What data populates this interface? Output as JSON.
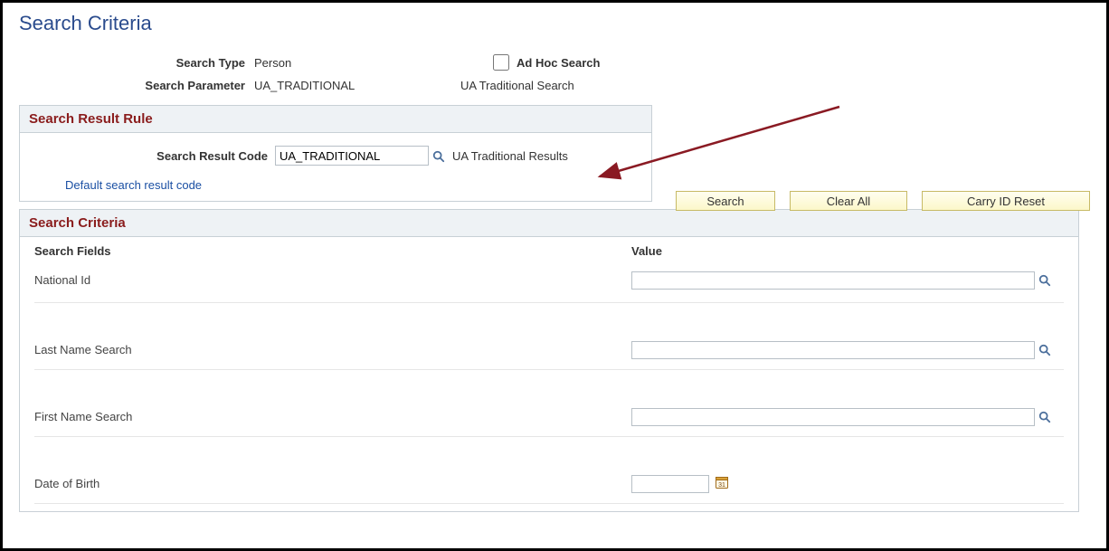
{
  "page": {
    "title": "Search Criteria"
  },
  "header": {
    "search_type_label": "Search Type",
    "search_type_value": "Person",
    "ad_hoc_label": "Ad Hoc Search",
    "search_param_label": "Search Parameter",
    "search_param_value": "UA_TRADITIONAL",
    "search_param_desc": "UA Traditional Search"
  },
  "result_rule": {
    "section_title": "Search Result Rule",
    "code_label": "Search Result Code",
    "code_value": "UA_TRADITIONAL",
    "code_desc": "UA Traditional Results",
    "default_link": "Default search result code"
  },
  "buttons": {
    "search": "Search",
    "clear_all": "Clear All",
    "carry_id_reset": "Carry ID Reset"
  },
  "criteria": {
    "section_title": "Search Criteria",
    "fields_header": "Search Fields",
    "value_header": "Value",
    "fields": [
      {
        "label": "National Id",
        "type": "lookup",
        "value": ""
      },
      {
        "label": "Last Name Search",
        "type": "lookup",
        "value": ""
      },
      {
        "label": "First Name Search",
        "type": "lookup",
        "value": ""
      },
      {
        "label": "Date of Birth",
        "type": "date",
        "value": ""
      }
    ]
  }
}
